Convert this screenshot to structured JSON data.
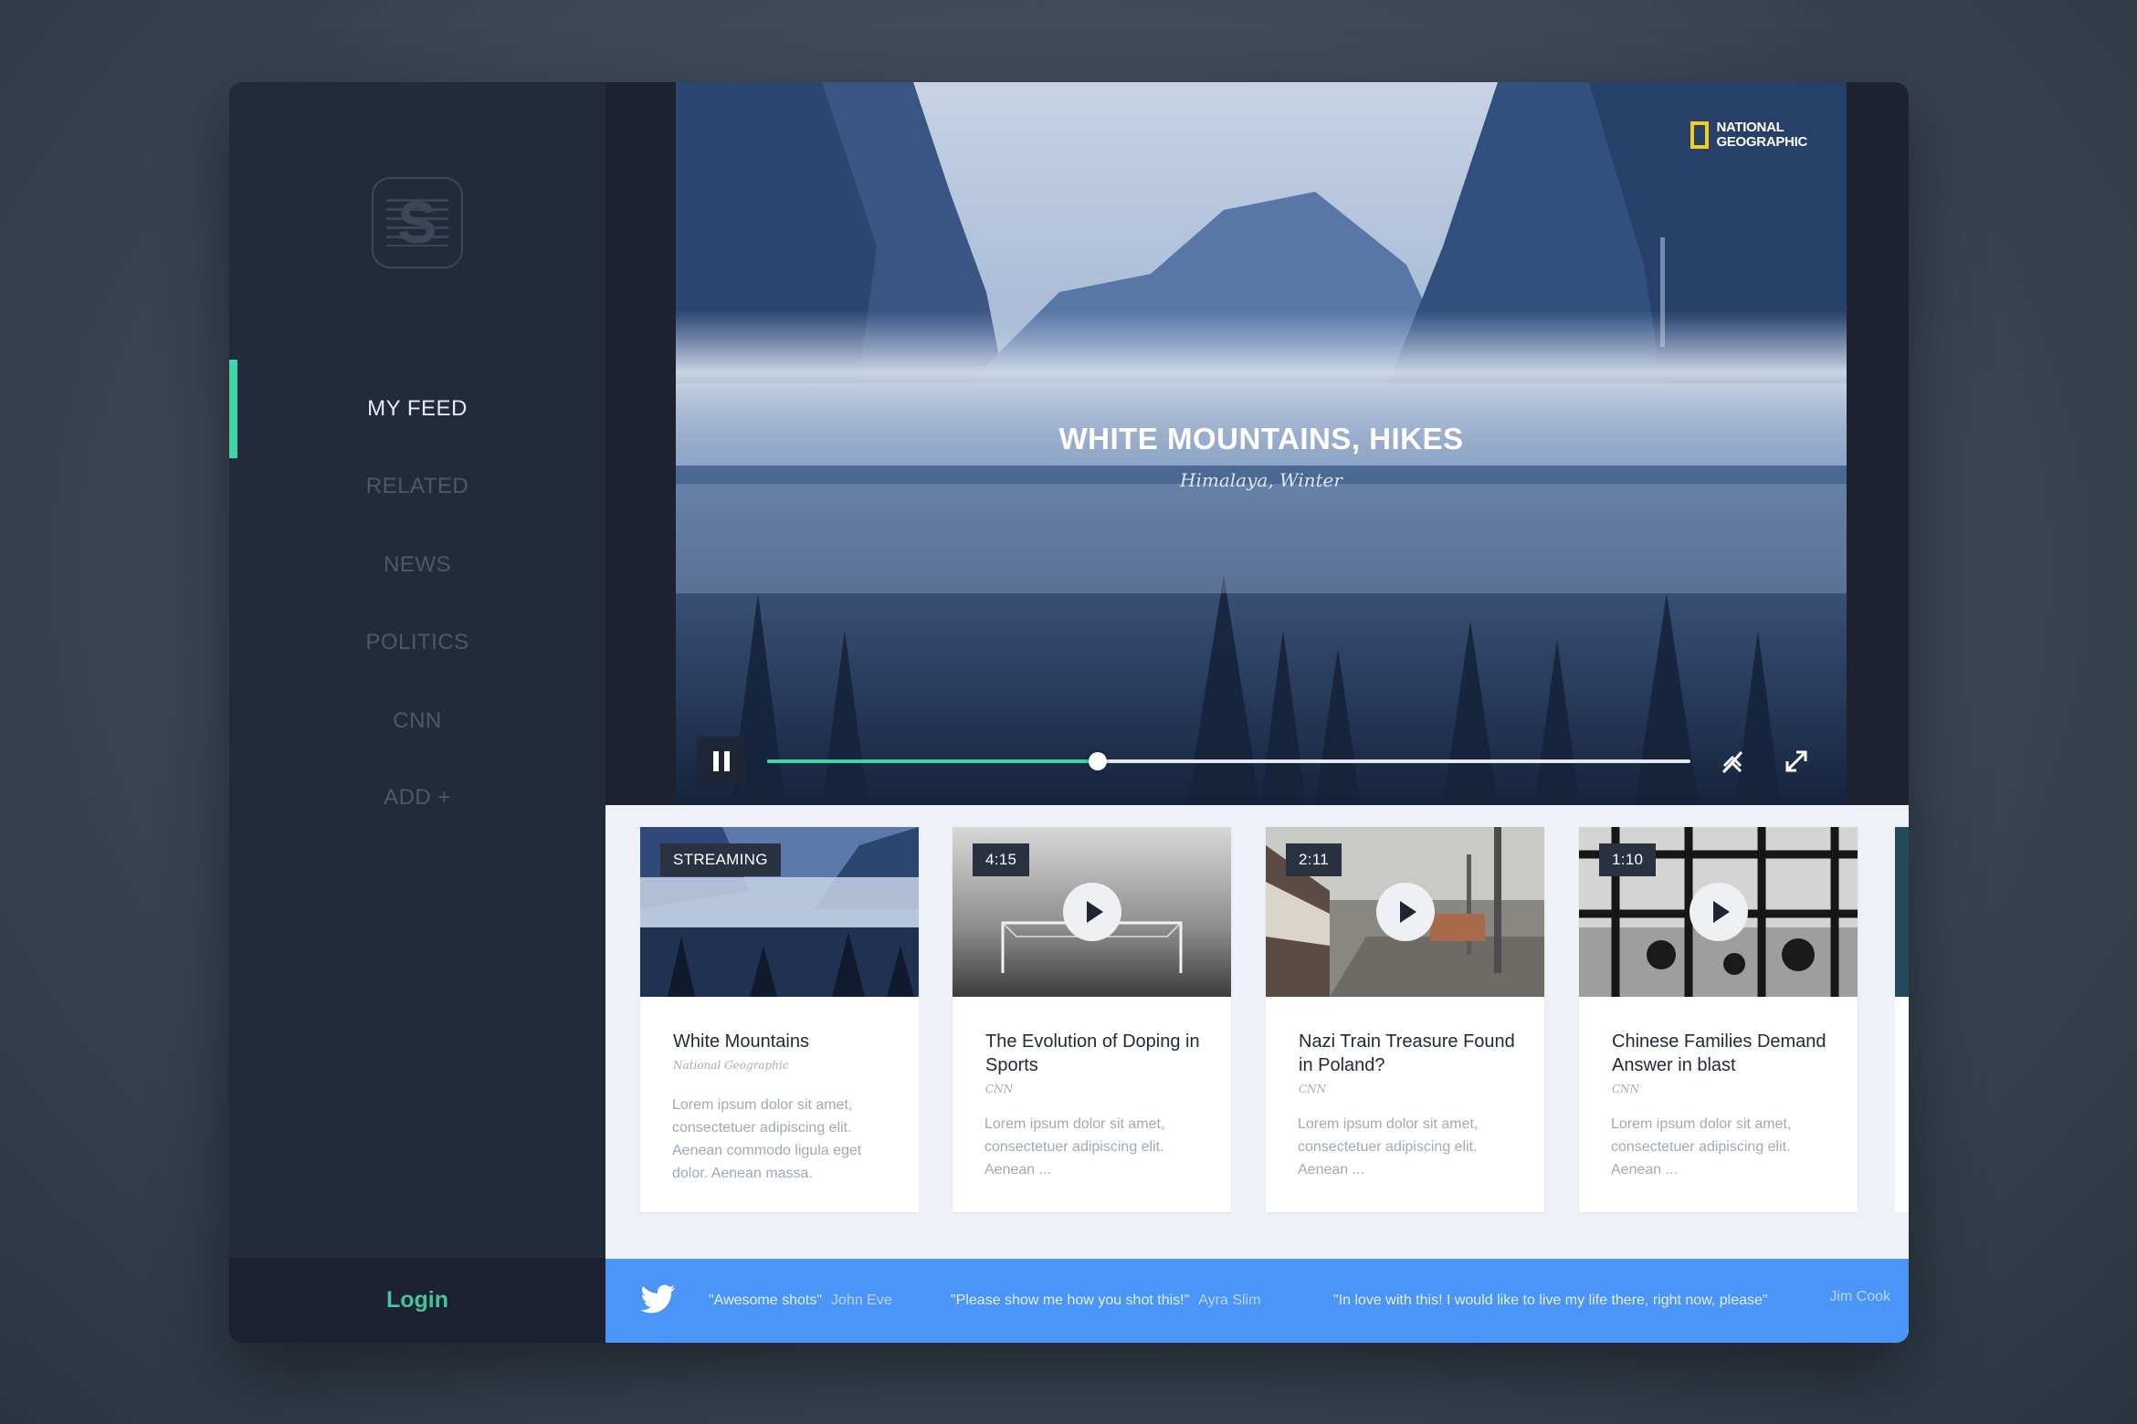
{
  "sidebar": {
    "logo_letter": "S",
    "items": [
      {
        "label": "MY FEED",
        "active": true
      },
      {
        "label": "RELATED",
        "active": false
      },
      {
        "label": "NEWS",
        "active": false
      },
      {
        "label": "POLITICS",
        "active": false
      },
      {
        "label": "CNN",
        "active": false
      },
      {
        "label": "ADD +",
        "active": false
      }
    ],
    "login_label": "Login",
    "accent": "#43d3a6"
  },
  "hero": {
    "title": "WHITE MOUNTAINS, HIKES",
    "subtitle": "Himalaya, Winter",
    "brand_line1": "NATIONAL",
    "brand_line2": "GEOGRAPHIC",
    "progress_fraction": 0.358,
    "icons": [
      "pause-icon",
      "quality-icon",
      "fullscreen-icon"
    ]
  },
  "cards": [
    {
      "badge": "STREAMING",
      "title": "White Mountains",
      "source": "National Geographic",
      "description": "Lorem ipsum dolor sit amet, consectetuer adipiscing elit. Aenean commodo ligula eget dolor. Aenean massa.",
      "has_play": false
    },
    {
      "badge": "4:15",
      "title": "The Evolution of Doping in Sports",
      "source": "CNN",
      "description": "Lorem ipsum dolor sit amet, consectetuer adipiscing elit. Aenean ...",
      "has_play": true
    },
    {
      "badge": "2:11",
      "title": "Nazi Train Treasure Found in Poland?",
      "source": "CNN",
      "description": "Lorem ipsum dolor sit amet, consectetuer adipiscing elit. Aenean ...",
      "has_play": true
    },
    {
      "badge": "1:10",
      "title": "Chinese Families Demand Answer in blast",
      "source": "CNN",
      "description": "Lorem ipsum dolor sit amet, consectetuer adipiscing elit. Aenean ...",
      "has_play": true
    }
  ],
  "twitter": {
    "tweets": [
      {
        "text": "\"Awesome shots\"",
        "author": "John Eve"
      },
      {
        "text": "\"Please show me how you shot this!\"",
        "author": "Ayra Slim"
      },
      {
        "text": "\"In love with this! I would like to live my life there, right now, please\"",
        "author": "Jim Cook"
      }
    ],
    "color": "#4a95f7"
  }
}
